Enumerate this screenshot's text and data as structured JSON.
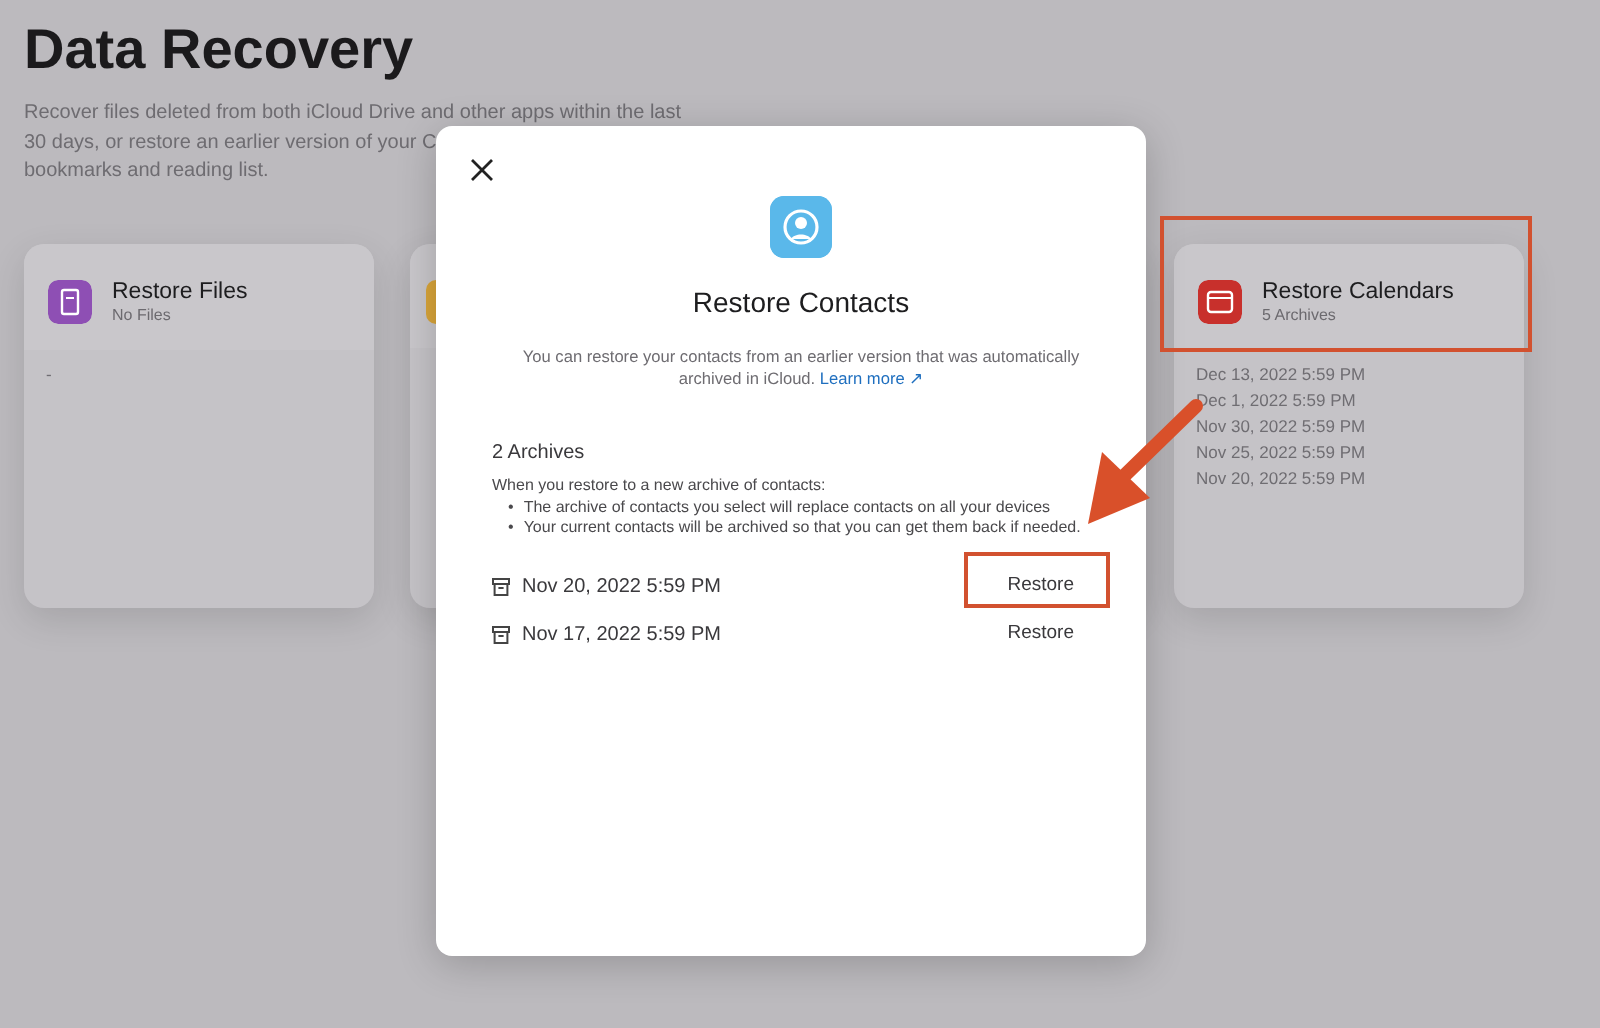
{
  "page": {
    "title": "Data Recovery",
    "description_lines": [
      "Recover files deleted from both iCloud Drive and other apps within the last",
      "30 days, or restore an earlier version of your C",
      "bookmarks and reading list."
    ]
  },
  "cards": [
    {
      "kind": "files",
      "title": "Restore Files",
      "subtitle": "No Files",
      "color": "#8e4fb4",
      "items": [
        "-"
      ]
    },
    {
      "kind": "hidden",
      "color": "#d9a53a"
    },
    {
      "kind": "calendars",
      "title": "Restore Calendars",
      "subtitle": "5 Archives",
      "color": "#c8302c",
      "items": [
        "Dec 13, 2022 5:59 PM",
        "Dec 1, 2022 5:59 PM",
        "Nov 30, 2022 5:59 PM",
        "Nov 25, 2022 5:59 PM",
        "Nov 20, 2022 5:59 PM"
      ]
    }
  ],
  "modal": {
    "title": "Restore Contacts",
    "description": "You can restore your contacts from an earlier version that was automatically archived in iCloud.",
    "link": "Learn more ↗",
    "archives_count": "2 Archives",
    "info_intro": "When you restore to a new archive of contacts:",
    "bullet": "•",
    "info_points": [
      "The archive of contacts you select will replace contacts on all your devices",
      "Your current contacts will be archived so that you can get them back if needed."
    ],
    "archives": [
      {
        "date": "Nov 20, 2022 5:59 PM",
        "action": "Restore"
      },
      {
        "date": "Nov 17, 2022 5:59 PM",
        "action": "Restore"
      }
    ]
  },
  "callouts": [
    {
      "kind": "box"
    },
    {
      "kind": "box"
    },
    {
      "kind": "arrow"
    }
  ]
}
